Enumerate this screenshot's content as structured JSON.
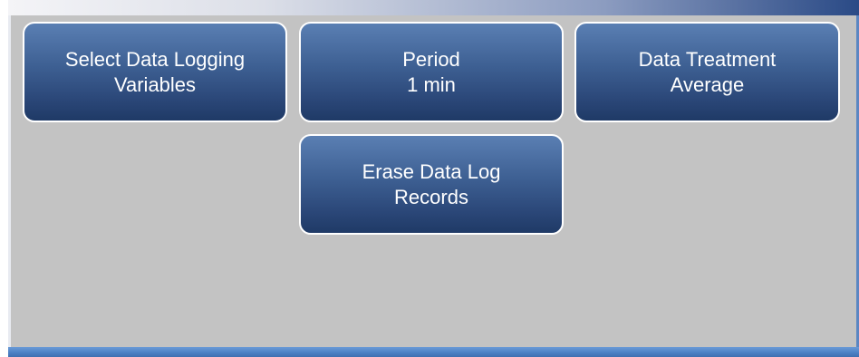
{
  "buttons": {
    "select_variables": {
      "line1": "Select Data Logging",
      "line2": "Variables"
    },
    "period": {
      "line1": "Period",
      "line2": "1 min"
    },
    "data_treatment": {
      "line1": "Data Treatment",
      "line2": "Average"
    },
    "erase_records": {
      "line1": "Erase Data Log",
      "line2": "Records"
    }
  },
  "colors": {
    "screen_background": "#c3c3c3",
    "button_top": "#5a7fb3",
    "button_bottom": "#1f3a66",
    "button_border": "#ffffff",
    "bottom_bar": "#4a7fc4"
  }
}
